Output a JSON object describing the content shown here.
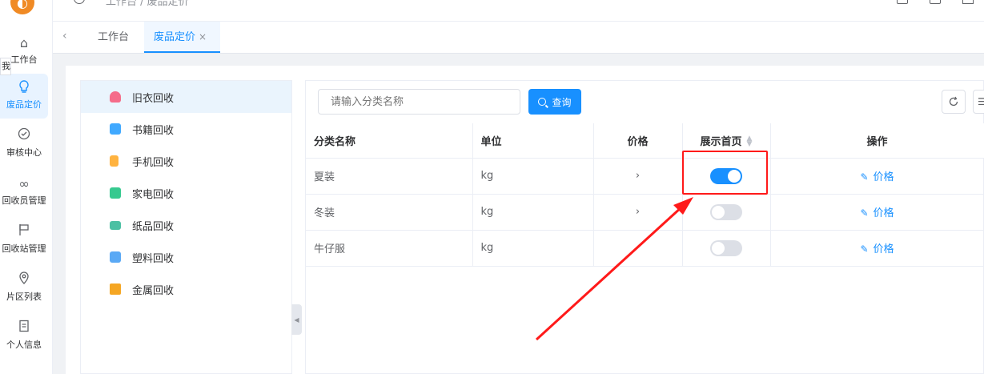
{
  "nav": {
    "items": [
      {
        "label": "工作台",
        "icon": "home-icon"
      },
      {
        "label": "废品定价",
        "icon": "bulb-icon"
      },
      {
        "label": "审核中心",
        "icon": "check-circle-icon"
      },
      {
        "label": "回收员管理",
        "icon": "infinity-icon"
      },
      {
        "label": "回收站管理",
        "icon": "flag-icon"
      },
      {
        "label": "片区列表",
        "icon": "location-icon"
      },
      {
        "label": "个人信息",
        "icon": "document-icon"
      }
    ],
    "tooltip": "我"
  },
  "topbar": {
    "breadcrumb": "工作台 / 废品定价"
  },
  "tabs": [
    {
      "label": "工作台"
    },
    {
      "label": "废品定价",
      "close": "×"
    }
  ],
  "categories": [
    {
      "label": "旧衣回收",
      "color": "#f56c8a"
    },
    {
      "label": "书籍回收",
      "color": "#40a9ff"
    },
    {
      "label": "手机回收",
      "color": "#ffb340"
    },
    {
      "label": "家电回收",
      "color": "#36c98f"
    },
    {
      "label": "纸品回收",
      "color": "#4bc0a3"
    },
    {
      "label": "塑料回收",
      "color": "#5aa9f5"
    },
    {
      "label": "金属回收",
      "color": "#f5a623"
    }
  ],
  "search": {
    "placeholder": "请输入分类名称",
    "button_label": "查询"
  },
  "table": {
    "headers": {
      "name": "分类名称",
      "unit": "单位",
      "price": "价格",
      "show_home": "展示首页",
      "ops": "操作"
    },
    "rows": [
      {
        "name": "夏装",
        "unit": "kg",
        "price": "›",
        "show_home": true,
        "op": "价格"
      },
      {
        "name": "冬装",
        "unit": "kg",
        "price": "›",
        "show_home": false,
        "op": "价格"
      },
      {
        "name": "牛仔服",
        "unit": "kg",
        "price": "",
        "show_home": false,
        "op": "价格"
      }
    ]
  },
  "colors": {
    "accent": "#1890ff",
    "annotation": "#ff1a1a"
  }
}
